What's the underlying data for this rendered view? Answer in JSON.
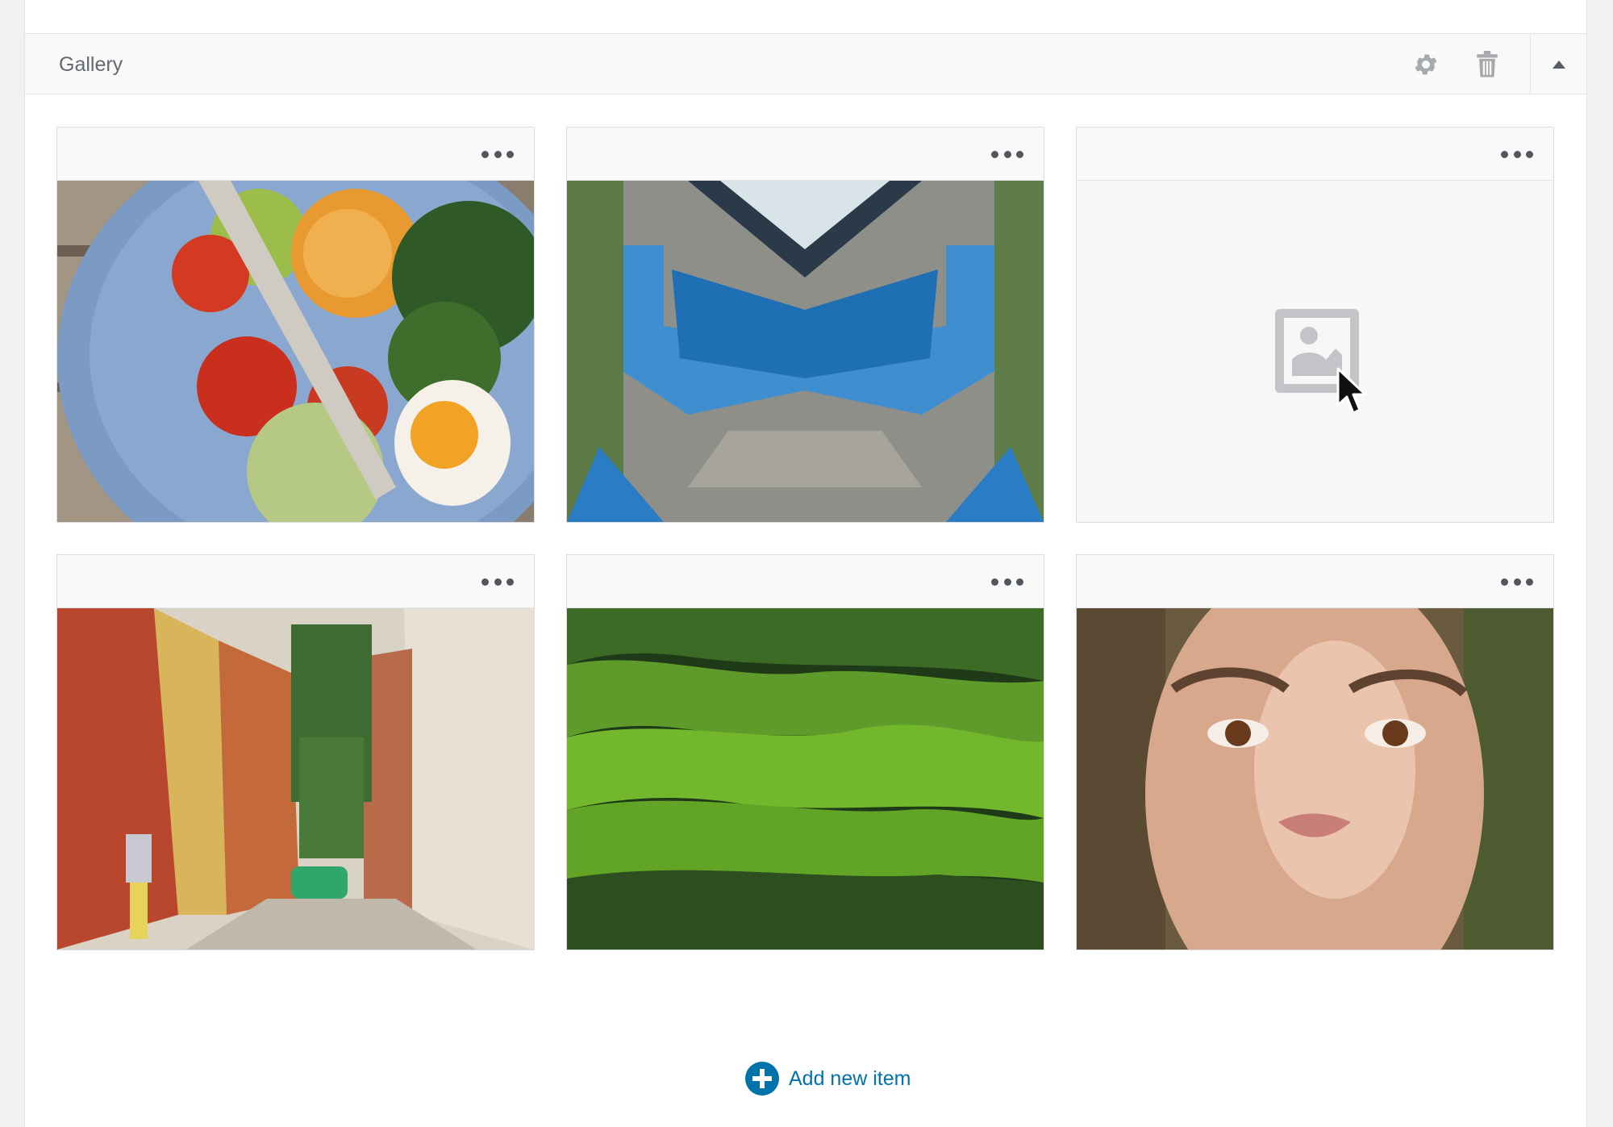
{
  "panel": {
    "title": "Gallery",
    "settings_icon": "gear-icon",
    "delete_icon": "trash-icon",
    "toggle_icon": "triangle-up-icon"
  },
  "gallery": {
    "items": [
      {
        "image": "salad-bowl-photo",
        "menu_icon": "ellipsis-icon"
      },
      {
        "image": "aerial-pool-photo",
        "menu_icon": "ellipsis-icon"
      },
      {
        "image": "image-placeholder-icon",
        "menu_icon": "ellipsis-icon"
      },
      {
        "image": "colorful-street-photo",
        "menu_icon": "ellipsis-icon"
      },
      {
        "image": "green-hills-photo",
        "menu_icon": "ellipsis-icon"
      },
      {
        "image": "woman-portrait-photo",
        "menu_icon": "ellipsis-icon"
      }
    ]
  },
  "add_item": {
    "label": "Add new item",
    "icon": "plus-circle-icon"
  },
  "colors": {
    "accent": "#0073aa",
    "header_bg": "#f9f9f9",
    "border": "#e2e4e7"
  }
}
